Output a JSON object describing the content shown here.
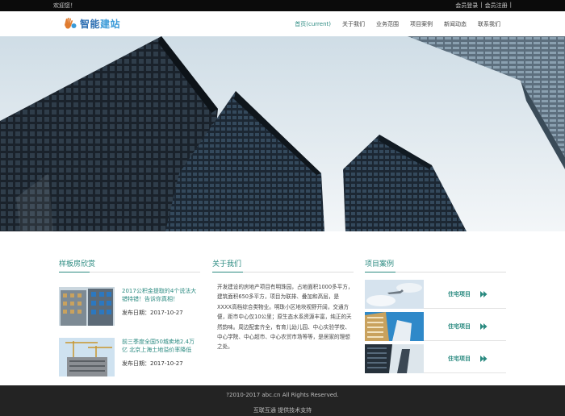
{
  "topbar": {
    "welcome": "欢迎您！",
    "login": "会员登录",
    "register": "会员注册"
  },
  "header": {
    "logo_text_1": "智能",
    "logo_text_2": "建站"
  },
  "nav": {
    "items": [
      "首页(current)",
      "关于我们",
      "业务范围",
      "项目案例",
      "新闻动态",
      "联系我们"
    ]
  },
  "sections": {
    "news": {
      "title": "样板房欣赏",
      "items": [
        {
          "headline": "2017公积金提取的4个说法大错特错！告诉你真相！",
          "date": "发布日期：2017-10-27"
        },
        {
          "headline": "前三季度全国50城卖地2.4万亿 北京上海土地溢价率降低",
          "date": "发布日期：2017-10-27"
        }
      ]
    },
    "about": {
      "title": "关于我们",
      "text": "开发建设的房地产项目有明珠园，占地面积1000多平方，建筑面积650多平方，项目为联排、叠加和高层，是XXXX高档综合类物业。明珠小区地块视野开阔，交通方便，距市中心仅10公里；原生态水系资源丰富，纯正的天然韵味。周边配套齐全，有育儿幼儿园、中心实验学校、中心学院、中心超市、中心农贸市场等等，是居家的理想之处。"
    },
    "cases": {
      "title": "项目案例",
      "items": [
        {
          "label": "住宅项目"
        },
        {
          "label": "住宅项目"
        },
        {
          "label": "住宅项目"
        }
      ]
    }
  },
  "footer": {
    "copyright": "?2010-2017 abc.cn All Rights Reserved.",
    "tech": "互联互通 提供技术支持"
  },
  "colors": {
    "accent": "#2a8a80",
    "topbar_bg": "#0b0b0b",
    "footer_bg": "#232323"
  }
}
